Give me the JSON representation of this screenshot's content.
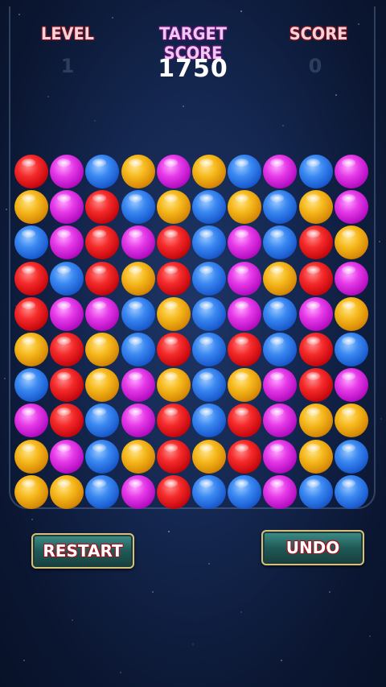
{
  "hud": {
    "level_label": "LEVEL",
    "level_value": "1",
    "target_label": "TARGET SCORE",
    "target_value": "1750",
    "score_label": "SCORE",
    "score_value": "0"
  },
  "board": {
    "rows": 10,
    "cols": 10,
    "colors": {
      "red": "#e8161c",
      "blue": "#2f7ae6",
      "purple": "#d42ad8",
      "yellow": "#f0ab16"
    },
    "grid": [
      [
        "red",
        "purple",
        "blue",
        "yellow",
        "purple",
        "yellow",
        "blue",
        "purple",
        "blue",
        "purple"
      ],
      [
        "yellow",
        "purple",
        "red",
        "blue",
        "yellow",
        "blue",
        "yellow",
        "blue",
        "yellow",
        "purple"
      ],
      [
        "blue",
        "purple",
        "red",
        "purple",
        "red",
        "blue",
        "purple",
        "blue",
        "red",
        "yellow"
      ],
      [
        "red",
        "blue",
        "red",
        "yellow",
        "red",
        "blue",
        "purple",
        "yellow",
        "red",
        "purple"
      ],
      [
        "red",
        "purple",
        "purple",
        "blue",
        "yellow",
        "blue",
        "purple",
        "blue",
        "purple",
        "yellow"
      ],
      [
        "yellow",
        "red",
        "yellow",
        "blue",
        "red",
        "blue",
        "red",
        "blue",
        "red",
        "blue"
      ],
      [
        "blue",
        "red",
        "yellow",
        "purple",
        "yellow",
        "blue",
        "yellow",
        "purple",
        "red",
        "purple"
      ],
      [
        "purple",
        "red",
        "blue",
        "purple",
        "red",
        "blue",
        "red",
        "purple",
        "yellow",
        "yellow"
      ],
      [
        "yellow",
        "purple",
        "blue",
        "yellow",
        "red",
        "yellow",
        "red",
        "purple",
        "yellow",
        "blue"
      ],
      [
        "yellow",
        "yellow",
        "blue",
        "purple",
        "red",
        "blue",
        "blue",
        "purple",
        "blue",
        "blue"
      ]
    ]
  },
  "buttons": {
    "restart_label": "RESTART",
    "undo_label": "UNDO"
  }
}
